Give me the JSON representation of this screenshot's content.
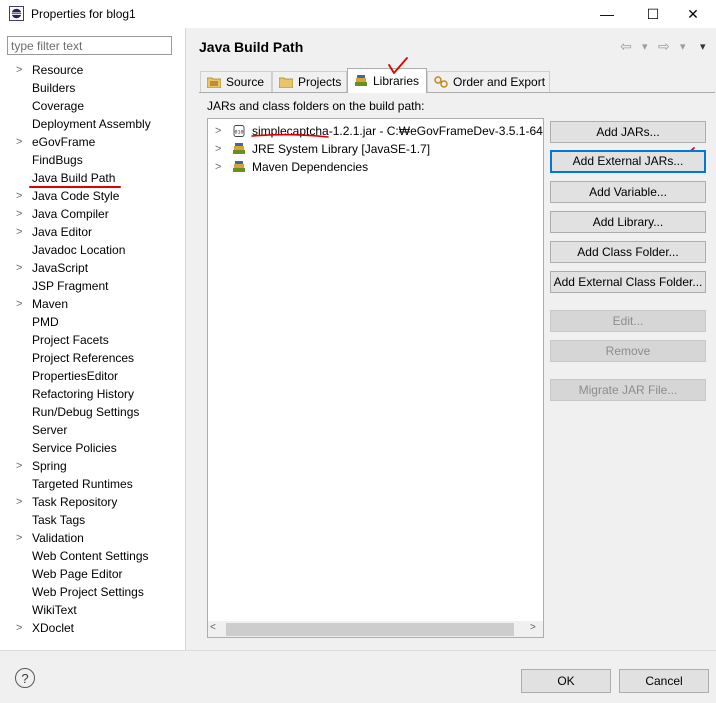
{
  "window": {
    "title": "Properties for blog1",
    "minimize": "—",
    "maximize": "☐",
    "close": "✕"
  },
  "filter": {
    "placeholder": "type filter text",
    "value": ""
  },
  "tree": [
    {
      "label": "Resource",
      "expandable": true
    },
    {
      "label": "Builders",
      "expandable": false
    },
    {
      "label": "Coverage",
      "expandable": false
    },
    {
      "label": "Deployment Assembly",
      "expandable": false
    },
    {
      "label": "eGovFrame",
      "expandable": true
    },
    {
      "label": "FindBugs",
      "expandable": false
    },
    {
      "label": "Java Build Path",
      "expandable": false,
      "selected": true
    },
    {
      "label": "Java Code Style",
      "expandable": true
    },
    {
      "label": "Java Compiler",
      "expandable": true
    },
    {
      "label": "Java Editor",
      "expandable": true
    },
    {
      "label": "Javadoc Location",
      "expandable": false
    },
    {
      "label": "JavaScript",
      "expandable": true
    },
    {
      "label": "JSP Fragment",
      "expandable": false
    },
    {
      "label": "Maven",
      "expandable": true
    },
    {
      "label": "PMD",
      "expandable": false
    },
    {
      "label": "Project Facets",
      "expandable": false
    },
    {
      "label": "Project References",
      "expandable": false
    },
    {
      "label": "PropertiesEditor",
      "expandable": false
    },
    {
      "label": "Refactoring History",
      "expandable": false
    },
    {
      "label": "Run/Debug Settings",
      "expandable": false
    },
    {
      "label": "Server",
      "expandable": false
    },
    {
      "label": "Service Policies",
      "expandable": false
    },
    {
      "label": "Spring",
      "expandable": true
    },
    {
      "label": "Targeted Runtimes",
      "expandable": false
    },
    {
      "label": "Task Repository",
      "expandable": true
    },
    {
      "label": "Task Tags",
      "expandable": false
    },
    {
      "label": "Validation",
      "expandable": true
    },
    {
      "label": "Web Content Settings",
      "expandable": false
    },
    {
      "label": "Web Page Editor",
      "expandable": false
    },
    {
      "label": "Web Project Settings",
      "expandable": false
    },
    {
      "label": "WikiText",
      "expandable": false
    },
    {
      "label": "XDoclet",
      "expandable": true
    }
  ],
  "page": {
    "title": "Java Build Path",
    "nav": {
      "back": "⇦",
      "back_menu": "▾",
      "forward": "⇨",
      "forward_menu": "▾",
      "view_menu": "▾"
    }
  },
  "tabs": [
    {
      "label": "Source",
      "icon": "source-folder-icon"
    },
    {
      "label": "Projects",
      "icon": "projects-folder-icon"
    },
    {
      "label": "Libraries",
      "icon": "libraries-icon",
      "active": true
    },
    {
      "label": "Order and Export",
      "icon": "order-export-icon"
    }
  ],
  "libraries": {
    "caption": "JARs and class folders on the build path:",
    "entries": [
      {
        "label_name": "simplecaptcha",
        "label_rest": "-1.2.1.jar - C:\\eGovFrameDev-3.5.1-64",
        "icon": "jar-file-icon"
      },
      {
        "label_name": "JRE System Library [JavaSE-1.7]",
        "label_rest": "",
        "icon": "library-icon"
      },
      {
        "label_name": "Maven Dependencies",
        "label_rest": "",
        "icon": "library-icon"
      }
    ],
    "path_prefix": "C:",
    "path_sep": "₩",
    "path_tail": "eGovFrameDev-3.5.1-64"
  },
  "buttons": {
    "add_jars": "Add JARs...",
    "add_external_jars": "Add External JARs...",
    "add_variable": "Add Variable...",
    "add_library": "Add Library...",
    "add_class_folder": "Add Class Folder...",
    "add_external_class_folder": "Add External Class Folder...",
    "edit": "Edit...",
    "remove": "Remove",
    "migrate_jar": "Migrate JAR File..."
  },
  "footer": {
    "help": "?",
    "ok": "OK",
    "cancel": "Cancel"
  },
  "colors": {
    "annotation_red": "#e00000",
    "focus_blue": "#0078d7",
    "java_orange": "#e8a33c"
  }
}
